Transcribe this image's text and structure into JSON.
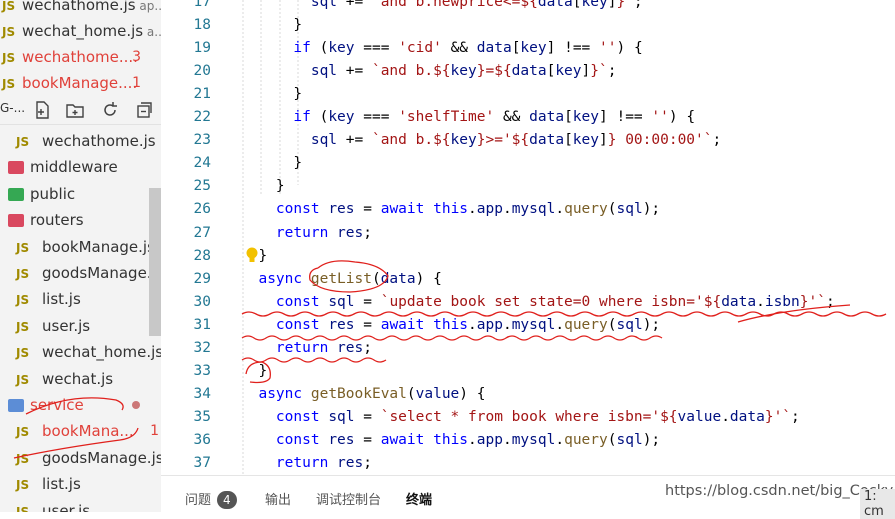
{
  "sidebar": {
    "open_editors": [
      {
        "label": "wechathome.js",
        "suffix": "ap...",
        "error": false,
        "badge": ""
      },
      {
        "label": "wechat_home.js",
        "suffix": "a...",
        "error": false,
        "badge": ""
      },
      {
        "label": "wechathome....",
        "suffix": "",
        "error": true,
        "badge": "3"
      },
      {
        "label": "bookManage....",
        "suffix": "",
        "error": true,
        "badge": "1"
      }
    ],
    "toolbar_prefix": "G-...",
    "tree": [
      {
        "label": "wechathome.js",
        "kind": "js",
        "error": false,
        "badge": ""
      },
      {
        "label": "middleware",
        "kind": "folder-red",
        "error": false,
        "badge": ""
      },
      {
        "label": "public",
        "kind": "folder-green",
        "error": false,
        "badge": ""
      },
      {
        "label": "routers",
        "kind": "folder-red",
        "error": false,
        "badge": ""
      },
      {
        "label": "bookManage.js",
        "kind": "js",
        "error": false,
        "badge": ""
      },
      {
        "label": "goodsManage.js",
        "kind": "js",
        "error": false,
        "badge": ""
      },
      {
        "label": "list.js",
        "kind": "js",
        "error": false,
        "badge": ""
      },
      {
        "label": "user.js",
        "kind": "js",
        "error": false,
        "badge": ""
      },
      {
        "label": "wechat_home.js",
        "kind": "js",
        "error": false,
        "badge": ""
      },
      {
        "label": "wechat.js",
        "kind": "js",
        "error": false,
        "badge": ""
      },
      {
        "label": "service",
        "kind": "folder-blue",
        "error": true,
        "badge": ""
      },
      {
        "label": "bookMana...",
        "kind": "js",
        "error": true,
        "badge": "1"
      },
      {
        "label": "goodsManage.js",
        "kind": "js",
        "error": false,
        "badge": ""
      },
      {
        "label": "list.js",
        "kind": "js",
        "error": false,
        "badge": ""
      },
      {
        "label": "user.js",
        "kind": "js",
        "error": false,
        "badge": ""
      }
    ],
    "js_icon_text": "JS"
  },
  "editor": {
    "lines": [
      {
        "n": "17",
        "tokens": [
          [
            "",
            "        "
          ],
          [
            "var",
            "sql"
          ],
          [
            "",
            " += "
          ],
          [
            "str",
            "`and b.newprice<=${"
          ],
          [
            "var",
            "data"
          ],
          [
            "",
            "["
          ],
          [
            "var",
            "key"
          ],
          [
            "",
            "]"
          ],
          [
            "str",
            "}`"
          ],
          [
            "",
            ";"
          ]
        ]
      },
      {
        "n": "18",
        "tokens": [
          [
            "",
            "      }"
          ]
        ]
      },
      {
        "n": "19",
        "tokens": [
          [
            "",
            "      "
          ],
          [
            "kw",
            "if"
          ],
          [
            "",
            " ("
          ],
          [
            "var",
            "key"
          ],
          [
            "",
            " === "
          ],
          [
            "str",
            "'cid'"
          ],
          [
            "",
            " && "
          ],
          [
            "var",
            "data"
          ],
          [
            "",
            "["
          ],
          [
            "var",
            "key"
          ],
          [
            "",
            "] !== "
          ],
          [
            "str",
            "''"
          ],
          [
            "",
            ") {"
          ]
        ]
      },
      {
        "n": "20",
        "tokens": [
          [
            "",
            "        "
          ],
          [
            "var",
            "sql"
          ],
          [
            "",
            " += "
          ],
          [
            "str",
            "`and b.${"
          ],
          [
            "var",
            "key"
          ],
          [
            "str",
            "}=${"
          ],
          [
            "var",
            "data"
          ],
          [
            "",
            "["
          ],
          [
            "var",
            "key"
          ],
          [
            "",
            "]"
          ],
          [
            "str",
            "}`"
          ],
          [
            "",
            ";"
          ]
        ]
      },
      {
        "n": "21",
        "tokens": [
          [
            "",
            "      }"
          ]
        ]
      },
      {
        "n": "22",
        "tokens": [
          [
            "",
            "      "
          ],
          [
            "kw",
            "if"
          ],
          [
            "",
            " ("
          ],
          [
            "var",
            "key"
          ],
          [
            "",
            " === "
          ],
          [
            "str",
            "'shelfTime'"
          ],
          [
            "",
            " && "
          ],
          [
            "var",
            "data"
          ],
          [
            "",
            "["
          ],
          [
            "var",
            "key"
          ],
          [
            "",
            "] !== "
          ],
          [
            "str",
            "''"
          ],
          [
            "",
            ") {"
          ]
        ]
      },
      {
        "n": "23",
        "tokens": [
          [
            "",
            "        "
          ],
          [
            "var",
            "sql"
          ],
          [
            "",
            " += "
          ],
          [
            "str",
            "`and b.${"
          ],
          [
            "var",
            "key"
          ],
          [
            "str",
            "}>='${"
          ],
          [
            "var",
            "data"
          ],
          [
            "",
            "["
          ],
          [
            "var",
            "key"
          ],
          [
            "",
            "]"
          ],
          [
            "str",
            "} 00:00:00'`"
          ],
          [
            "",
            ";"
          ]
        ]
      },
      {
        "n": "24",
        "tokens": [
          [
            "",
            "      }"
          ]
        ]
      },
      {
        "n": "25",
        "tokens": [
          [
            "",
            "    }"
          ]
        ]
      },
      {
        "n": "26",
        "tokens": [
          [
            "",
            "    "
          ],
          [
            "kw",
            "const"
          ],
          [
            "",
            " "
          ],
          [
            "var",
            "res"
          ],
          [
            "",
            " = "
          ],
          [
            "kw",
            "await"
          ],
          [
            "",
            " "
          ],
          [
            "kw",
            "this"
          ],
          [
            "",
            "."
          ],
          [
            "prop",
            "app"
          ],
          [
            "",
            "."
          ],
          [
            "prop",
            "mysql"
          ],
          [
            "",
            "."
          ],
          [
            "fn",
            "query"
          ],
          [
            "",
            "("
          ],
          [
            "var",
            "sql"
          ],
          [
            "",
            ");"
          ]
        ]
      },
      {
        "n": "27",
        "tokens": [
          [
            "",
            "    "
          ],
          [
            "kw",
            "return"
          ],
          [
            "",
            " "
          ],
          [
            "var",
            "res"
          ],
          [
            "",
            ";"
          ]
        ]
      },
      {
        "n": "28",
        "tokens": [
          [
            "",
            "  }"
          ]
        ]
      },
      {
        "n": "29",
        "tokens": [
          [
            "",
            "  "
          ],
          [
            "kw",
            "async"
          ],
          [
            "",
            " "
          ],
          [
            "fn",
            "getList"
          ],
          [
            "",
            "("
          ],
          [
            "var",
            "data"
          ],
          [
            "",
            ") {"
          ]
        ]
      },
      {
        "n": "30",
        "tokens": [
          [
            "",
            "    "
          ],
          [
            "kw",
            "const"
          ],
          [
            "",
            " "
          ],
          [
            "var",
            "sql"
          ],
          [
            "",
            " = "
          ],
          [
            "str",
            "`update book set state=0 where isbn='${"
          ],
          [
            "var",
            "data"
          ],
          [
            "",
            "."
          ],
          [
            "prop",
            "isbn"
          ],
          [
            "str",
            "}'`"
          ],
          [
            "",
            ";"
          ]
        ]
      },
      {
        "n": "31",
        "tokens": [
          [
            "",
            "    "
          ],
          [
            "kw",
            "const"
          ],
          [
            "",
            " "
          ],
          [
            "var",
            "res"
          ],
          [
            "",
            " = "
          ],
          [
            "kw",
            "await"
          ],
          [
            "",
            " "
          ],
          [
            "kw",
            "this"
          ],
          [
            "",
            "."
          ],
          [
            "prop",
            "app"
          ],
          [
            "",
            "."
          ],
          [
            "prop",
            "mysql"
          ],
          [
            "",
            "."
          ],
          [
            "fn",
            "query"
          ],
          [
            "",
            "("
          ],
          [
            "var",
            "sql"
          ],
          [
            "",
            ");"
          ]
        ]
      },
      {
        "n": "32",
        "tokens": [
          [
            "",
            "    "
          ],
          [
            "kw",
            "return"
          ],
          [
            "",
            " "
          ],
          [
            "var",
            "res"
          ],
          [
            "",
            ";"
          ]
        ]
      },
      {
        "n": "33",
        "tokens": [
          [
            "",
            "  }"
          ]
        ]
      },
      {
        "n": "34",
        "tokens": [
          [
            "",
            "  "
          ],
          [
            "kw",
            "async"
          ],
          [
            "",
            " "
          ],
          [
            "fn",
            "getBookEval"
          ],
          [
            "",
            "("
          ],
          [
            "var",
            "value"
          ],
          [
            "",
            ") {"
          ]
        ]
      },
      {
        "n": "35",
        "tokens": [
          [
            "",
            "    "
          ],
          [
            "kw",
            "const"
          ],
          [
            "",
            " "
          ],
          [
            "var",
            "sql"
          ],
          [
            "",
            " = "
          ],
          [
            "str",
            "`select * from book where isbn='${"
          ],
          [
            "var",
            "value"
          ],
          [
            "",
            "."
          ],
          [
            "prop",
            "data"
          ],
          [
            "str",
            "}'`"
          ],
          [
            "",
            ";"
          ]
        ]
      },
      {
        "n": "36",
        "tokens": [
          [
            "",
            "    "
          ],
          [
            "kw",
            "const"
          ],
          [
            "",
            " "
          ],
          [
            "var",
            "res"
          ],
          [
            "",
            " = "
          ],
          [
            "kw",
            "await"
          ],
          [
            "",
            " "
          ],
          [
            "kw",
            "this"
          ],
          [
            "",
            "."
          ],
          [
            "prop",
            "app"
          ],
          [
            "",
            "."
          ],
          [
            "prop",
            "mysql"
          ],
          [
            "",
            "."
          ],
          [
            "fn",
            "query"
          ],
          [
            "",
            "("
          ],
          [
            "var",
            "sql"
          ],
          [
            "",
            ");"
          ]
        ]
      },
      {
        "n": "37",
        "tokens": [
          [
            "",
            "    "
          ],
          [
            "kw",
            "return"
          ],
          [
            "",
            " "
          ],
          [
            "var",
            "res"
          ],
          [
            "",
            ";"
          ]
        ]
      }
    ]
  },
  "panel": {
    "problems_label": "问题",
    "problems_count": "4",
    "output_label": "输出",
    "debug_console_label": "调试控制台",
    "terminal_label": "终端",
    "terminal_select": "1: cm"
  },
  "watermark": "https://blog.csdn.net/big_Cocky",
  "colors": {
    "error": "#e0413a",
    "keyword": "#0000ff",
    "string": "#a31515",
    "function": "#795e26",
    "line_number": "#237893",
    "annotation": "#e0201c"
  }
}
